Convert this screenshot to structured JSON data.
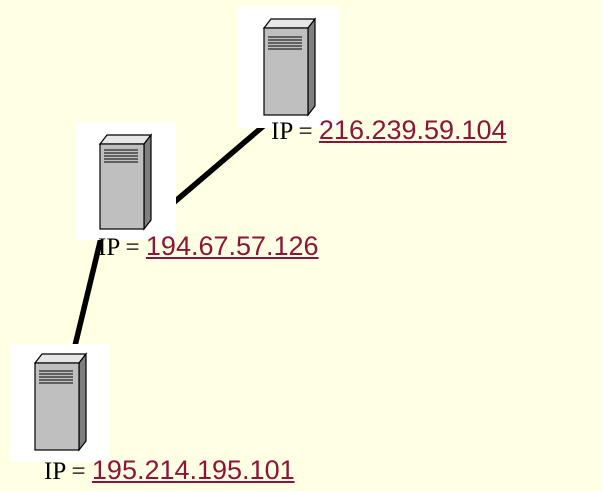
{
  "colors": {
    "background": "#ffffe3",
    "link": "#8b1538",
    "line": "#000000",
    "server_body": "#bfbfbf"
  },
  "servers": [
    {
      "icon": "server-icon",
      "ip_prefix": "IP = ",
      "ip_address": "216.239.59.104"
    },
    {
      "icon": "server-icon",
      "ip_prefix": "IP = ",
      "ip_address": "194.67.57.126"
    },
    {
      "icon": "server-icon",
      "ip_prefix": "IP = ",
      "ip_address": "195.214.195.101"
    }
  ]
}
